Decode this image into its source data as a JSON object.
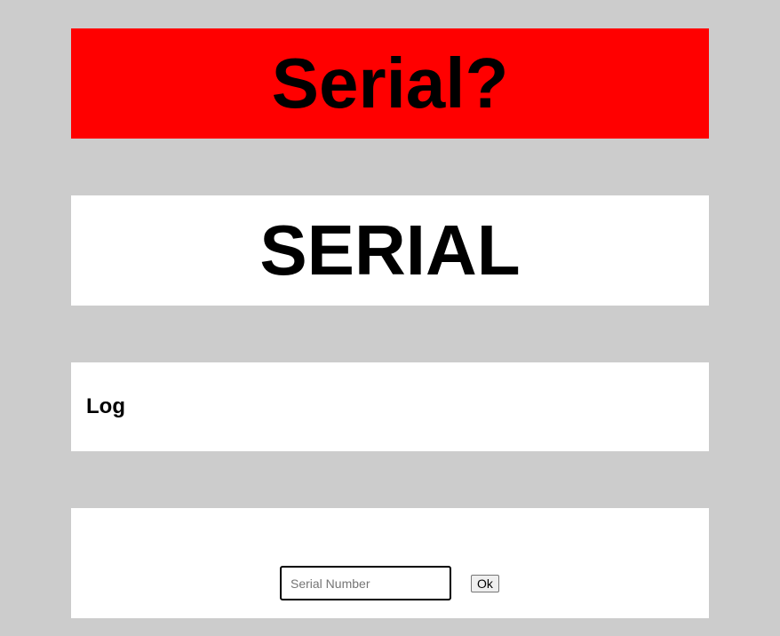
{
  "banner": {
    "title": "Serial?",
    "color": "#ff0000"
  },
  "display": {
    "serial_text": "SERIAL"
  },
  "log": {
    "heading": "Log"
  },
  "form": {
    "serial_placeholder": "Serial Number",
    "serial_value": "",
    "ok_label": "Ok"
  }
}
